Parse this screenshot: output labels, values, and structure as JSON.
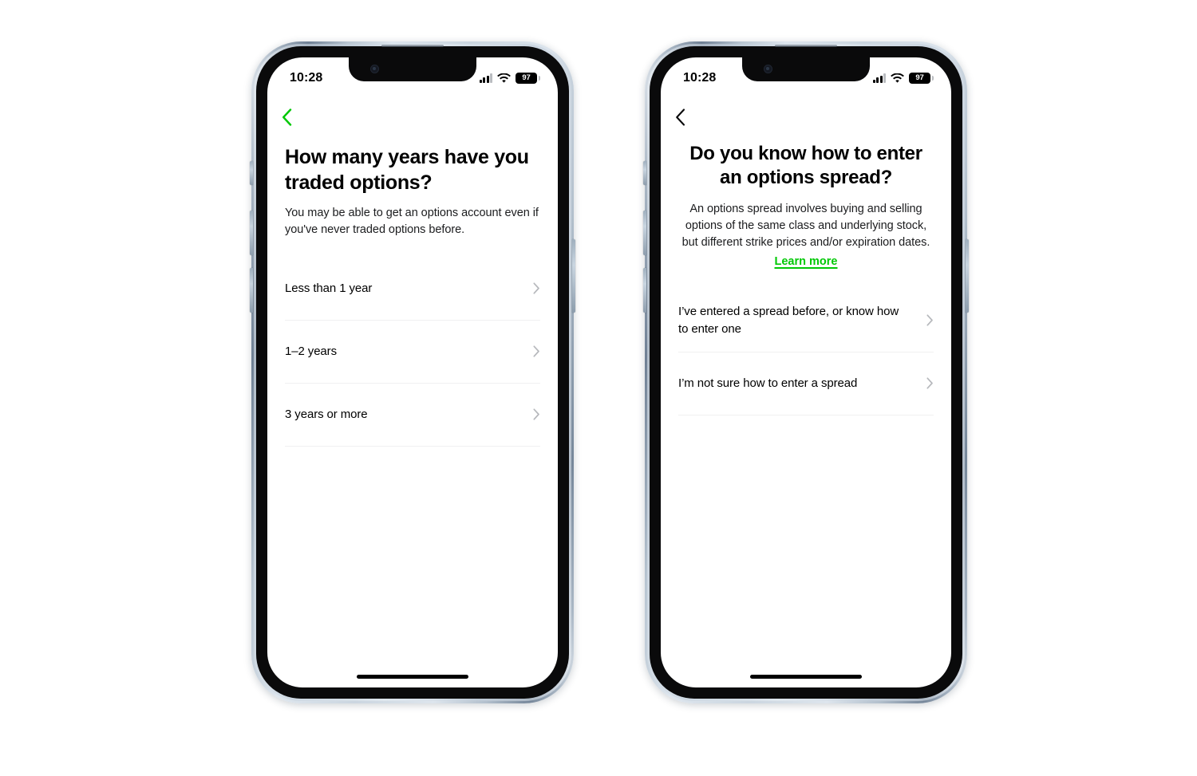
{
  "theme": {
    "accent_green": "#00C805",
    "text_primary": "#000000",
    "text_secondary": "#1B1C1E",
    "chevron_grey": "#B6B8BC",
    "divider": "#F0F0F1",
    "screen_bg": "#FFFFFF"
  },
  "status_bar": {
    "time": "10:28",
    "battery_percent": "97",
    "cellular_icon": "cellular-signal-icon",
    "wifi_icon": "wifi-icon",
    "battery_icon": "battery-icon"
  },
  "screens": [
    {
      "id": "years-traded-options",
      "back_icon": "chevron-left-icon",
      "back_icon_color": "#00C805",
      "align": "left",
      "title": "How many years have you traded options?",
      "subtitle": "You may be able to get an options account even if you've never traded options before.",
      "learn_more": null,
      "options": [
        {
          "label": "Less than 1 year",
          "chevron": "chevron-right-icon"
        },
        {
          "label": "1–2 years",
          "chevron": "chevron-right-icon"
        },
        {
          "label": "3 years or more",
          "chevron": "chevron-right-icon"
        }
      ]
    },
    {
      "id": "options-spread-knowledge",
      "back_icon": "chevron-left-icon",
      "back_icon_color": "#000000",
      "align": "center",
      "title": "Do you know how to enter an options spread?",
      "subtitle": "An options spread involves buying and selling options of the same class and underlying stock, but different strike prices and/or expiration dates.",
      "learn_more": "Learn more",
      "options": [
        {
          "label": "I’ve entered a spread before, or know how to enter one",
          "chevron": "chevron-right-icon"
        },
        {
          "label": "I’m not sure how to enter a spread",
          "chevron": "chevron-right-icon"
        }
      ]
    }
  ]
}
